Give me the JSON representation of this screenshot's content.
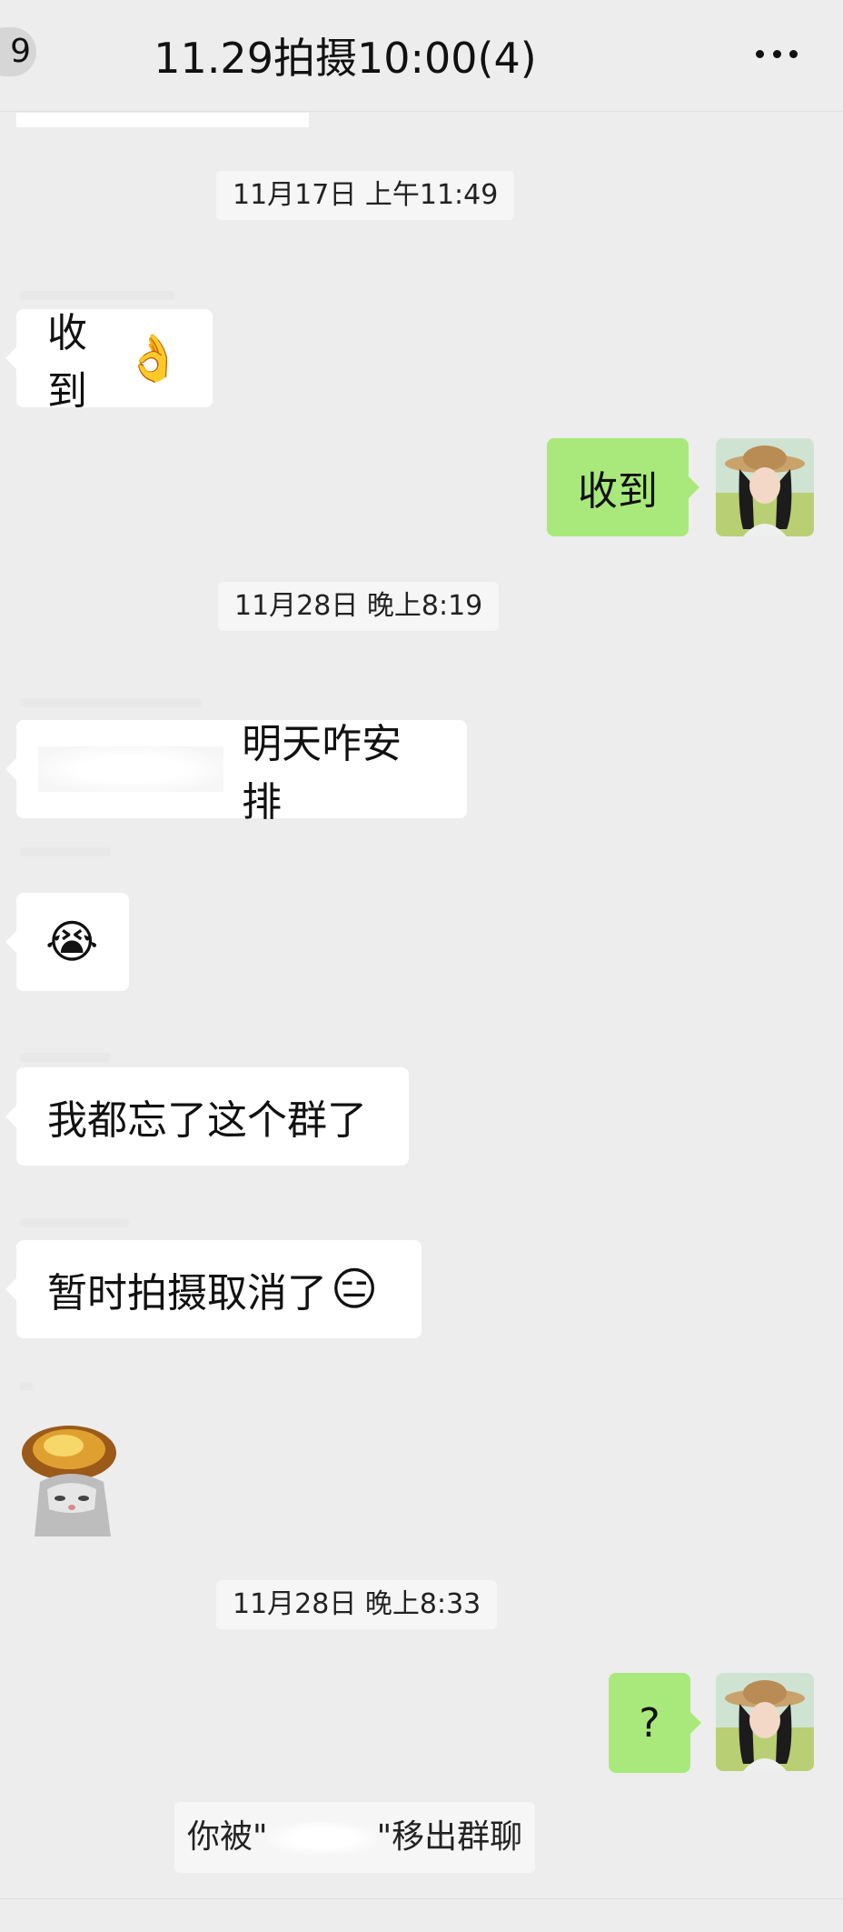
{
  "header": {
    "back_badge": "9",
    "title": "11.29拍摄10:00(4)",
    "more_icon": "more-horizontal-icon"
  },
  "messages": {
    "ts1": "11月17日 上午11:49",
    "m1_text": "收到",
    "m1_emoji": "👌",
    "m2_text": "收到",
    "ts2": "11月28日 晚上8:19",
    "m3_text": "明天咋安排",
    "m4_emoji": "😭",
    "m5_text": "我都忘了这个群了",
    "m6_text": "暂时拍摄取消了",
    "m6_emoji": "😑",
    "ts3": "11月28日 晚上8:33",
    "m8_text": "?",
    "notice_prefix": "你被\"",
    "notice_suffix": "\"移出群聊"
  },
  "colors": {
    "background": "#ededed",
    "bubble_self": "#a9e97c",
    "bubble_other": "#ffffff"
  }
}
